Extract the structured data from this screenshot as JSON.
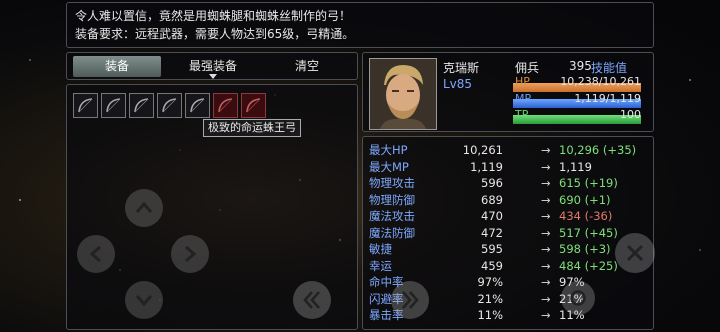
{
  "description": {
    "line1": "令人难以置信，竟然是用蜘蛛腿和蜘蛛丝制作的弓！",
    "line2": "装备要求：远程武器，需要人物达到65级，弓精通。"
  },
  "tabs": [
    {
      "label": "装备",
      "active": true
    },
    {
      "label": "最强装备",
      "active": false
    },
    {
      "label": "清空",
      "active": false
    }
  ],
  "inventory": {
    "slots": [
      {
        "icon": "bow-icon",
        "rarity": "normal"
      },
      {
        "icon": "bow-icon",
        "rarity": "normal"
      },
      {
        "icon": "bow-icon",
        "rarity": "normal"
      },
      {
        "icon": "bow-icon",
        "rarity": "normal"
      },
      {
        "icon": "bow-icon",
        "rarity": "normal"
      },
      {
        "icon": "bow-icon",
        "rarity": "red"
      },
      {
        "icon": "bow-icon",
        "rarity": "red"
      }
    ],
    "tooltip": "极致的命运蛛王弓"
  },
  "character": {
    "name": "克瑞斯",
    "level": "Lv85",
    "job": "佣兵",
    "skill_points_value": "395",
    "skill_points_label": "技能值",
    "hp_label": "HP",
    "hp_value": "10,238/10,261",
    "hp_fraction": 0.998,
    "mp_label": "MP",
    "mp_value": "1,119/1,119",
    "mp_fraction": 1.0,
    "tp_label": "TP",
    "tp_value": "100",
    "tp_fraction": 1.0
  },
  "stats": [
    {
      "label": "最大HP",
      "current": "10,261",
      "new": "10,296 (+35)",
      "trend": "up"
    },
    {
      "label": "最大MP",
      "current": "1,119",
      "new": "1,119",
      "trend": "same"
    },
    {
      "label": "物理攻击",
      "current": "596",
      "new": "615 (+19)",
      "trend": "up"
    },
    {
      "label": "物理防御",
      "current": "689",
      "new": "690 (+1)",
      "trend": "up"
    },
    {
      "label": "魔法攻击",
      "current": "470",
      "new": "434 (-36)",
      "trend": "down"
    },
    {
      "label": "魔法防御",
      "current": "472",
      "new": "517 (+45)",
      "trend": "up"
    },
    {
      "label": "敏捷",
      "current": "595",
      "new": "598 (+3)",
      "trend": "up"
    },
    {
      "label": "幸运",
      "current": "459",
      "new": "484 (+25)",
      "trend": "up"
    },
    {
      "label": "命中率",
      "current": "97%",
      "new": "97%",
      "trend": "same"
    },
    {
      "label": "闪避率",
      "current": "21%",
      "new": "21%",
      "trend": "same"
    },
    {
      "label": "暴击率",
      "current": "11%",
      "new": "11%",
      "trend": "same"
    }
  ],
  "arrow_glyph": "→",
  "colors": {
    "stat_label": "#7da8ff",
    "increase": "#7ee07a",
    "decrease": "#e07a6a",
    "hp_bar": "#e08a45",
    "mp_bar": "#4a80f0",
    "tp_bar": "#3fbf50"
  }
}
